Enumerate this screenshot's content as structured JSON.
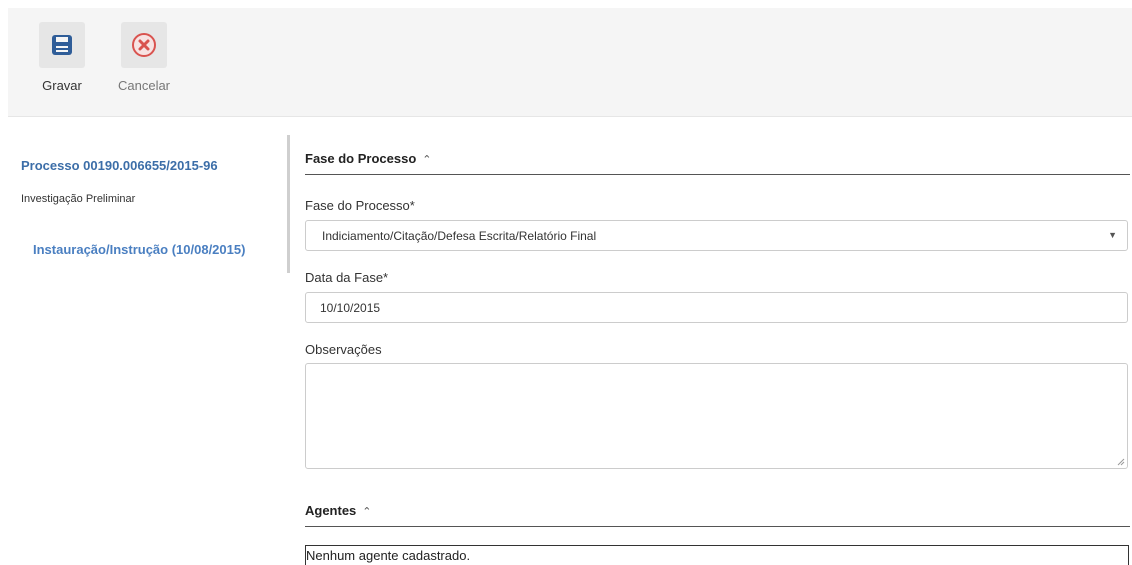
{
  "toolbar": {
    "save_label": "Gravar",
    "cancel_label": "Cancelar",
    "save_icon": "floppy-disk-icon",
    "cancel_icon": "close-circle-icon"
  },
  "sidebar": {
    "process_title": "Processo 00190.006655/2015-96",
    "process_subtitle": "Investigação Preliminar",
    "phase_link": "Instauração/Instrução (10/08/2015)"
  },
  "main": {
    "section_phase_title": "Fase do Processo",
    "phase_label": "Fase do Processo*",
    "phase_value": "Indiciamento/Citação/Defesa Escrita/Relatório Final",
    "date_label": "Data da Fase*",
    "date_value": "10/10/2015",
    "notes_label": "Observações",
    "notes_value": "",
    "section_agents_title": "Agentes",
    "agents_empty": "Nenhum agente cadastrado."
  },
  "colors": {
    "accent": "#2f5d98",
    "link": "#4a7fc1",
    "cancel_red": "#d9534f"
  }
}
